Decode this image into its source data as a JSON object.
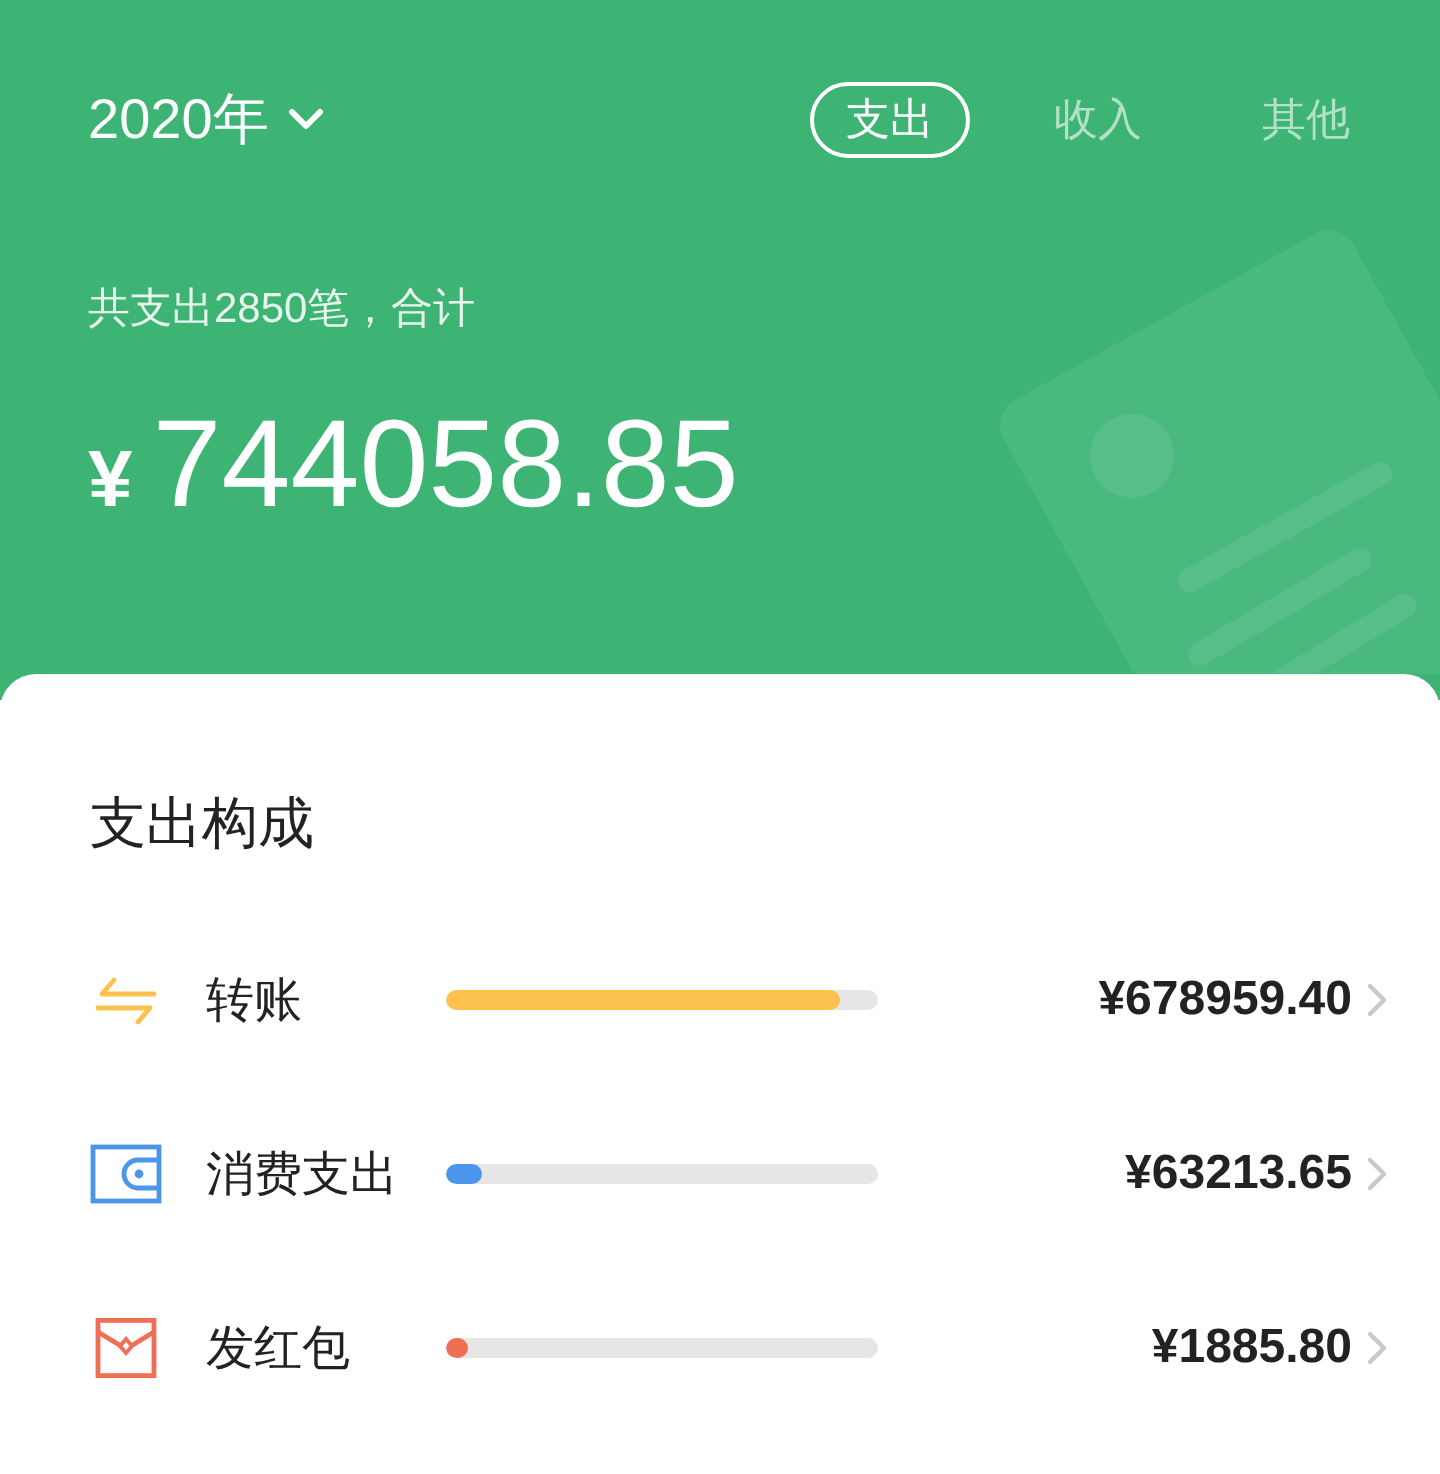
{
  "header": {
    "year": "2020年",
    "tabs": [
      {
        "label": "支出",
        "selected": true
      },
      {
        "label": "收入",
        "selected": false
      },
      {
        "label": "其他",
        "selected": false
      }
    ],
    "summary": "共支出2850笔，合计",
    "currency": "¥",
    "total": "744058.85"
  },
  "breakdown": {
    "title": "支出构成",
    "items": [
      {
        "kind": "transfer",
        "label": "转账",
        "level": 0.91,
        "color": "#fcc24d",
        "amount": "¥678959.40"
      },
      {
        "kind": "wallet",
        "label": "消费支出",
        "level": 0.085,
        "color": "#4c95ec",
        "amount": "¥63213.65"
      },
      {
        "kind": "red_packet",
        "label": "发红包",
        "level": 0.05,
        "color": "#ef6f55",
        "amount": "¥1885.80"
      }
    ]
  }
}
